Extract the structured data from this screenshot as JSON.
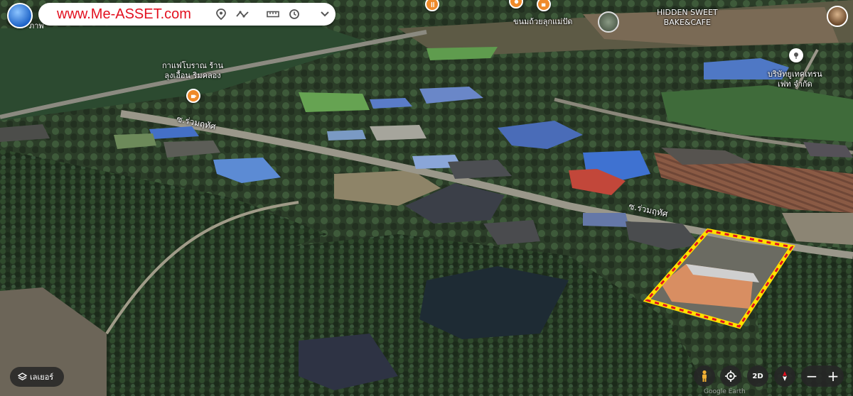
{
  "app": {
    "brand_text": "www.Me-ASSET.com",
    "behind_text": "ภาพ"
  },
  "toolbar": {
    "icons": [
      "location-pin-icon",
      "path-icon",
      "ruler-icon",
      "history-icon",
      "chevron-down-icon"
    ]
  },
  "map": {
    "places": [
      {
        "id": "hidden-sweet",
        "lines": [
          "HIDDEN SWEET",
          "BAKE&CAFE"
        ]
      },
      {
        "id": "khanom",
        "lines": [
          "ขนมถ้วยลุกแม่ปัด"
        ]
      },
      {
        "id": "coffee",
        "lines": [
          "กาแฟโบราณ ร้าน",
          "ลุงเอื้อน ริมคลอง"
        ]
      },
      {
        "id": "company",
        "lines": [
          "บริษัทยูเทคเทรน",
          "เฟท จำกัด"
        ]
      }
    ],
    "roads": [
      {
        "id": "road-upper",
        "label": "ซ.ร่วมฤทัศ"
      },
      {
        "id": "road-lower",
        "label": "ซ.ร่วมฤทัศ"
      }
    ],
    "highlight_color": "#ffe100",
    "highlight_dash_color": "#e3101f"
  },
  "controls": {
    "layers_label": "เลเยอร์",
    "mode_2d": "2D",
    "zoom_out": "−",
    "zoom_in": "+",
    "attribution": "Google Earth"
  },
  "colors": {
    "brand": "#e3101f",
    "poi": "#ef8a2a",
    "control_bg": "#262626"
  }
}
